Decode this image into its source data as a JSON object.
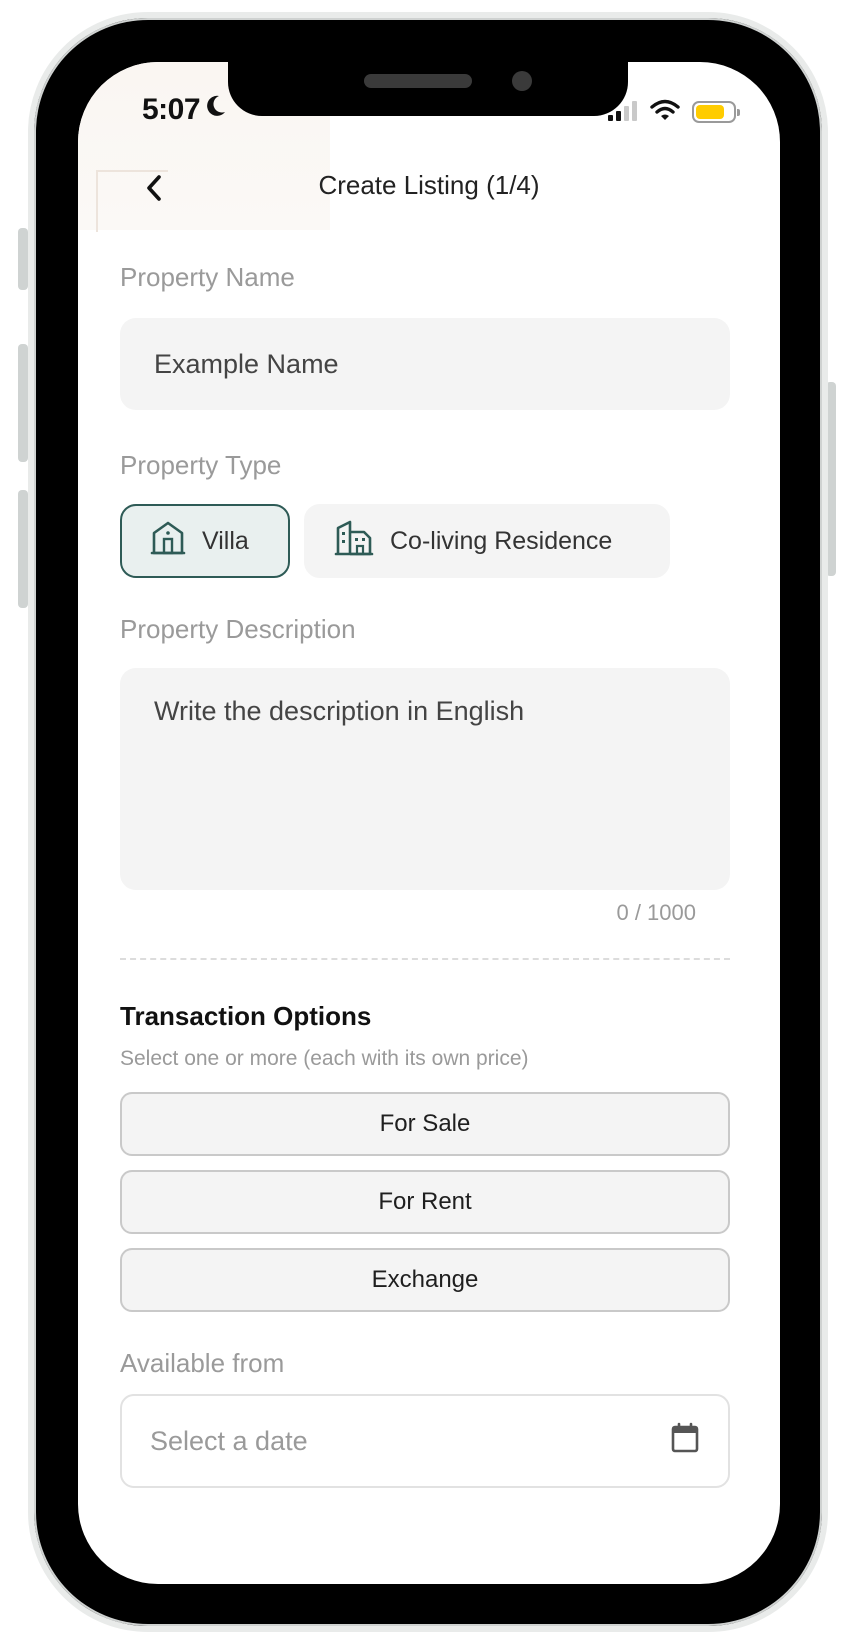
{
  "status_bar": {
    "time": "5:07",
    "moon_icon": "moon-icon",
    "signal_icon": "cellular-signal-icon",
    "wifi_icon": "wifi-icon",
    "battery_icon": "battery-icon",
    "battery_color": "#ffcc00"
  },
  "header": {
    "back_icon": "chevron-left-icon",
    "title": "Create Listing (1/4)"
  },
  "form": {
    "property_name": {
      "label": "Property Name",
      "value": "Example Name"
    },
    "property_type": {
      "label": "Property Type",
      "options": [
        {
          "label": "Villa",
          "icon": "house-icon",
          "selected": true
        },
        {
          "label": "Co-living Residence",
          "icon": "buildings-icon",
          "selected": false
        }
      ]
    },
    "property_description": {
      "label": "Property Description",
      "placeholder": "Write the description in English",
      "counter": "0 / 1000"
    },
    "transaction_options": {
      "title": "Transaction Options",
      "subtitle": "Select one or more (each with its own price)",
      "options": [
        "For Sale",
        "For Rent",
        "Exchange"
      ]
    },
    "available_from": {
      "label": "Available from",
      "placeholder": "Select a date",
      "icon": "calendar-icon"
    }
  },
  "colors": {
    "accent": "#2e5b56",
    "selected_chip_bg": "#e9f0ef",
    "field_bg": "#f4f4f4",
    "label_gray": "#9a9a9a"
  }
}
